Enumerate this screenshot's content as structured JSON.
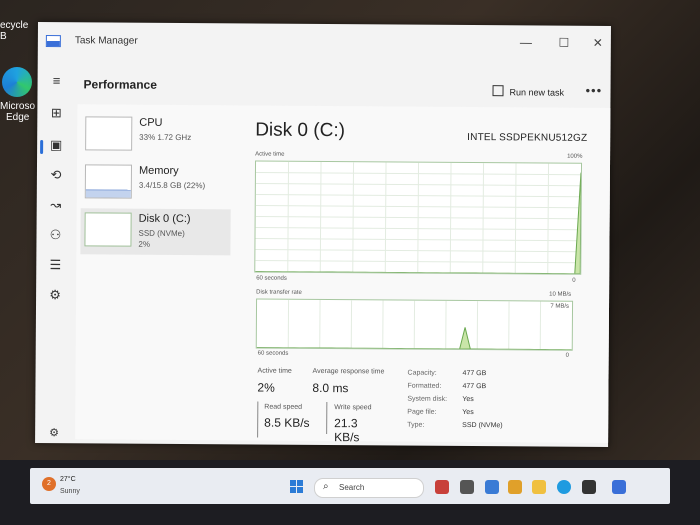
{
  "desktop": {
    "recycle_label": "ecycle B",
    "edge_label_1": "Microso",
    "edge_label_2": "Edge"
  },
  "window": {
    "title": "Task Manager",
    "min_glyph": "—",
    "max_glyph": "☐",
    "close_glyph": "✕"
  },
  "header": {
    "title": "Performance",
    "run_new_task": "Run new task",
    "more": "•••"
  },
  "rail_icons": [
    "hamburger-icon",
    "processes-icon",
    "performance-icon",
    "app-history-icon",
    "startup-icon",
    "users-icon",
    "details-icon",
    "services-icon",
    "settings-icon"
  ],
  "rail_glyphs": {
    "menu": "≡",
    "processes": "⊞",
    "performance": "▣",
    "history": "⟲",
    "startup": "↝",
    "users": "⚇",
    "details": "☰",
    "services": "⚙",
    "settings": "⚙"
  },
  "sidebar": [
    {
      "title": "CPU",
      "sub1": "33%  1.72 GHz",
      "sub2": ""
    },
    {
      "title": "Memory",
      "sub1": "3.4/15.8 GB (22%)",
      "sub2": ""
    },
    {
      "title": "Disk 0 (C:)",
      "sub1": "SSD (NVMe)",
      "sub2": "2%"
    }
  ],
  "memory_usage_fraction": 0.22,
  "detail": {
    "title": "Disk 0 (C:)",
    "model": "INTEL SSDPEKNU512GZ",
    "graph1": {
      "label": "Active time",
      "max": "100%",
      "left": "60 seconds",
      "right": "0",
      "values": [
        0,
        0,
        0,
        0,
        0,
        0,
        0,
        0,
        0,
        0,
        0,
        0,
        0,
        0,
        0,
        0,
        0,
        0,
        0,
        0,
        0,
        0,
        0,
        0,
        0,
        0,
        0,
        0,
        0,
        0,
        0,
        0,
        0,
        0,
        0,
        0,
        0,
        0,
        0,
        0,
        0,
        0,
        0,
        0,
        0,
        0,
        0,
        0,
        0,
        0,
        0,
        0,
        0,
        0,
        0,
        0,
        0,
        0,
        0,
        92
      ]
    },
    "graph2": {
      "label": "Disk transfer rate",
      "max": "10 MB/s",
      "inner_max": "7 MB/s",
      "left": "60 seconds",
      "right": "0",
      "values": [
        0,
        0,
        0,
        0,
        0,
        0,
        0,
        0,
        0,
        0,
        0,
        0,
        0,
        0,
        0,
        0,
        0,
        0,
        0,
        0,
        0,
        0,
        0,
        0,
        0,
        0,
        0,
        0,
        0,
        0,
        0,
        0,
        0,
        0,
        0,
        0,
        0,
        0,
        0,
        45,
        0,
        0,
        0,
        0,
        0,
        0,
        0,
        0,
        0,
        0,
        0,
        0,
        0,
        0,
        0,
        0,
        0,
        0,
        0,
        0
      ]
    },
    "stats": {
      "active_time_label": "Active time",
      "active_time_value": "2%",
      "avg_resp_label": "Average response time",
      "avg_resp_value": "8.0 ms",
      "read_label": "Read speed",
      "read_value": "8.5 KB/s",
      "write_label": "Write speed",
      "write_value": "21.3 KB/s"
    },
    "props": [
      {
        "k": "Capacity:",
        "v": "477 GB"
      },
      {
        "k": "Formatted:",
        "v": "477 GB"
      },
      {
        "k": "System disk:",
        "v": "Yes"
      },
      {
        "k": "Page file:",
        "v": "Yes"
      },
      {
        "k": "Type:",
        "v": "SSD (NVMe)"
      }
    ]
  },
  "taskbar": {
    "weather_badge": "2",
    "weather_temp": "27°C",
    "weather_cond": "Sunny",
    "search_icon": "⌕",
    "search_label": "Search"
  }
}
